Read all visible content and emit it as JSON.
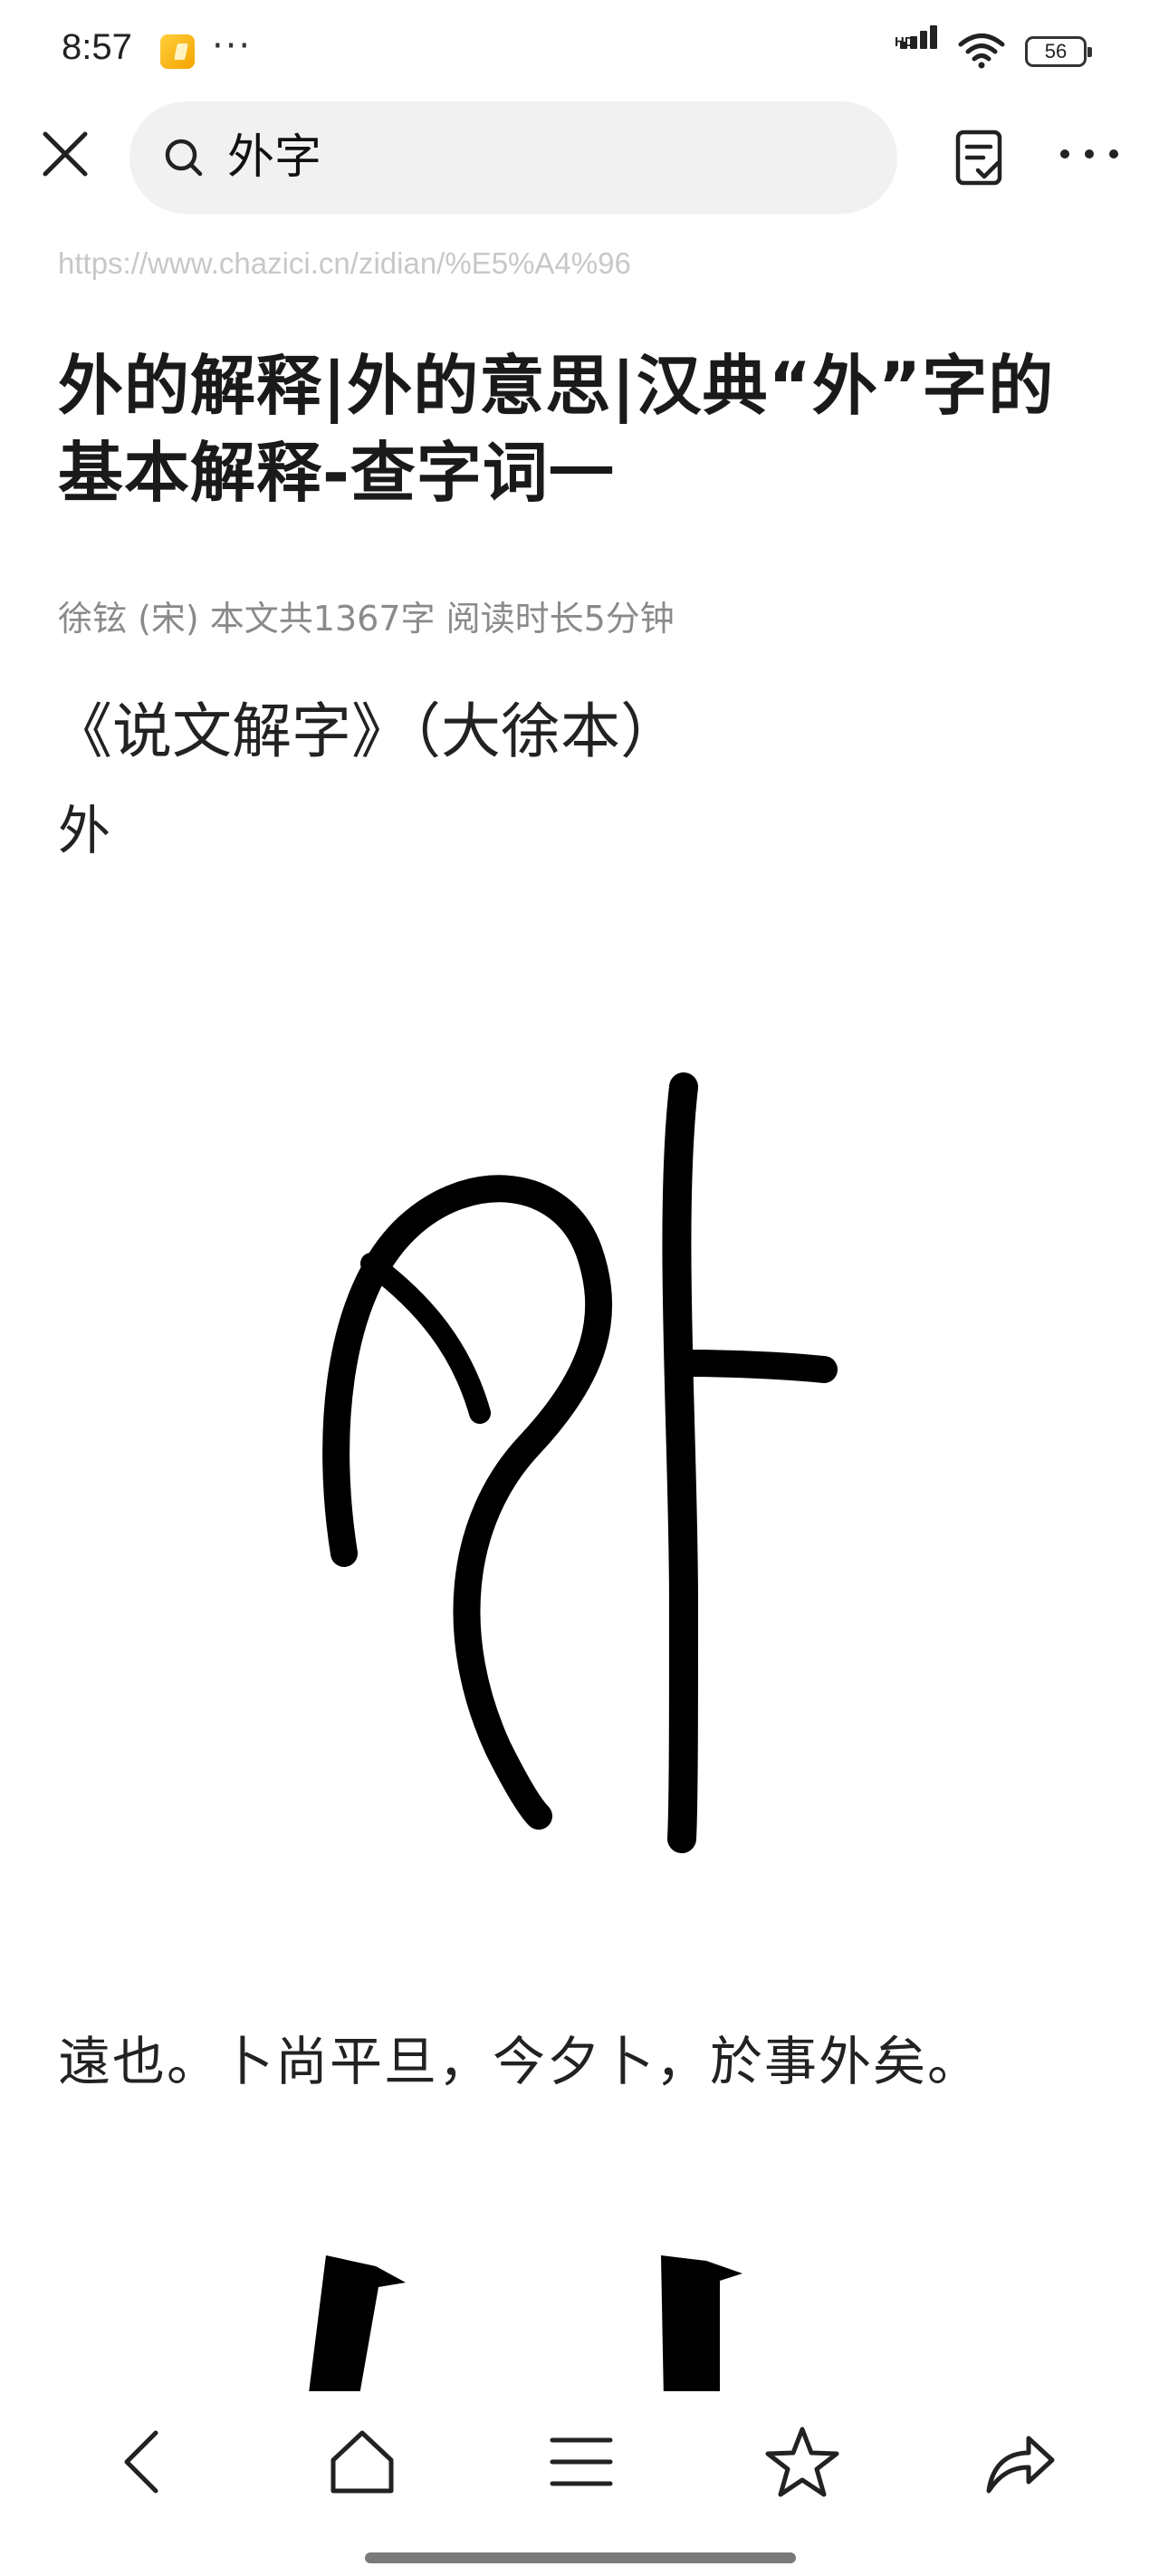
{
  "status_bar": {
    "time": "8:57",
    "more": "···",
    "network_label": "HD",
    "battery": "56"
  },
  "toolbar": {
    "close_icon": "close-icon",
    "search_query": "外字",
    "reader_icon": "reader-mode-icon",
    "menu_icon": "more-icon"
  },
  "page": {
    "url": "https://www.chazici.cn/zidian/%E5%A4%96",
    "title": "外的解释|外的意思|汉典“外”字的基本解释-查字词一",
    "meta": "徐铉 (宋) 本文共1367字 阅读时长5分钟",
    "section_title": "《说文解字》（大徐本）",
    "char_label": "外",
    "seal_image": "seal-script-character",
    "body_text": "遠也。卜尚平旦，今夕卜，於事外矣。"
  },
  "bottom_nav": {
    "back_icon": "back-icon",
    "home_icon": "home-icon",
    "tabs_icon": "menu-list-icon",
    "bookmark_icon": "star-icon",
    "share_icon": "share-icon"
  },
  "colors": {
    "search_bg": "#f1f1f1",
    "url_text": "#c8c8c8",
    "meta_text": "#8a8a8a",
    "text": "#1a1a1a"
  }
}
